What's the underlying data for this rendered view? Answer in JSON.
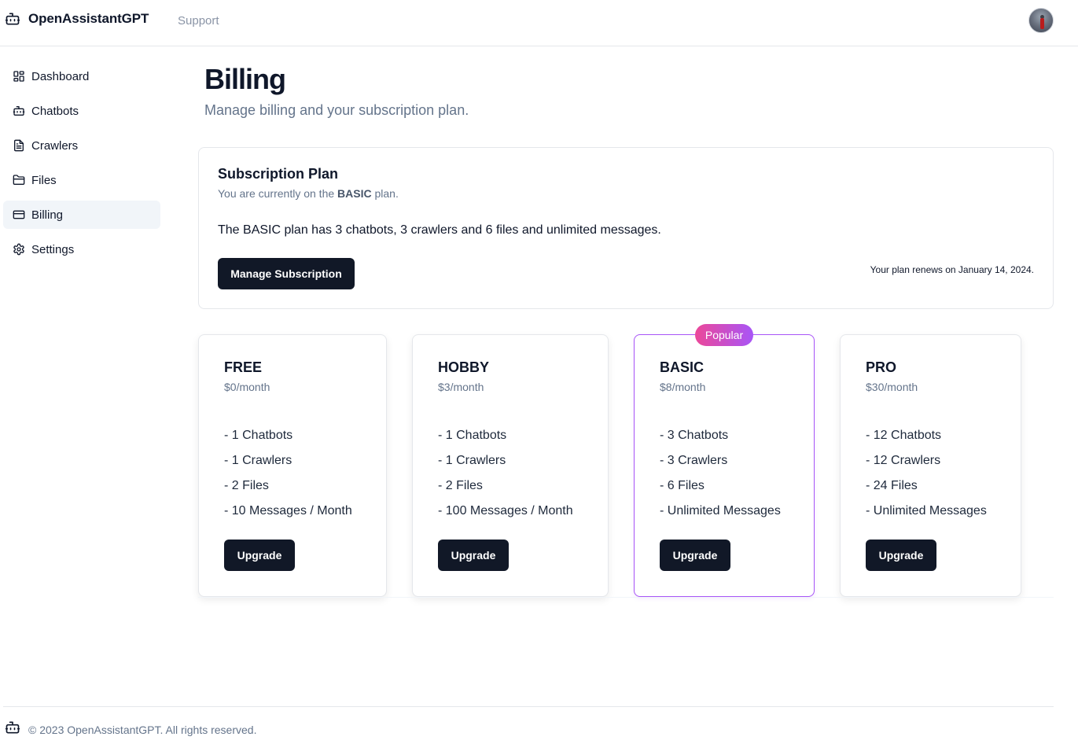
{
  "app": {
    "name": "OpenAssistantGPT",
    "support_label": "Support"
  },
  "sidebar": {
    "items": [
      {
        "label": "Dashboard",
        "icon": "dashboard-icon"
      },
      {
        "label": "Chatbots",
        "icon": "bot-icon"
      },
      {
        "label": "Crawlers",
        "icon": "file-icon"
      },
      {
        "label": "Files",
        "icon": "folder-icon"
      },
      {
        "label": "Billing",
        "icon": "credit-card-icon",
        "active": true
      },
      {
        "label": "Settings",
        "icon": "gear-icon"
      }
    ]
  },
  "page": {
    "title": "Billing",
    "subtitle": "Manage billing and your subscription plan."
  },
  "subscription": {
    "title": "Subscription Plan",
    "current_prefix": "You are currently on the ",
    "current_plan": "BASIC",
    "current_suffix": " plan.",
    "description": "The BASIC plan has 3 chatbots, 3 crawlers and 6 files and unlimited messages.",
    "manage_label": "Manage Subscription",
    "renewal": "Your plan renews on January 14, 2024."
  },
  "plans": [
    {
      "name": "FREE",
      "price": "$0/month",
      "features": [
        "- 1 Chatbots",
        "- 1 Crawlers",
        "- 2 Files",
        "- 10 Messages / Month"
      ],
      "button": "Upgrade"
    },
    {
      "name": "HOBBY",
      "price": "$3/month",
      "features": [
        "- 1 Chatbots",
        "- 1 Crawlers",
        "- 2 Files",
        "- 100 Messages / Month"
      ],
      "button": "Upgrade"
    },
    {
      "name": "BASIC",
      "price": "$8/month",
      "badge": "Popular",
      "features": [
        "- 3 Chatbots",
        "- 3 Crawlers",
        "- 6 Files",
        "- Unlimited Messages"
      ],
      "button": "Upgrade"
    },
    {
      "name": "PRO",
      "price": "$30/month",
      "features": [
        "- 12 Chatbots",
        "- 12 Crawlers",
        "- 24 Files",
        "- Unlimited Messages"
      ],
      "button": "Upgrade"
    }
  ],
  "footer": {
    "text": "© 2023 OpenAssistantGPT. All rights reserved."
  },
  "colors": {
    "primary_button": "#111827",
    "popular_border": "#a855f7",
    "badge_gradient_start": "#ec4899",
    "badge_gradient_end": "#a855f7",
    "active_nav_bg": "#f1f5f9"
  }
}
